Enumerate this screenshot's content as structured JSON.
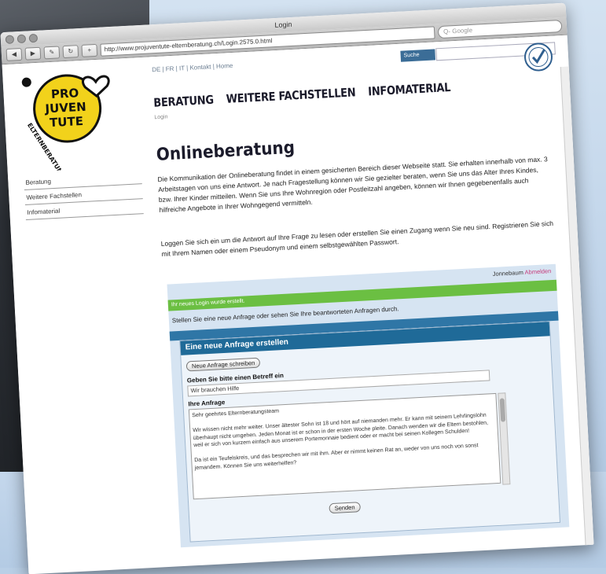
{
  "browser": {
    "title": "Login",
    "url": "http://www.projuventute-elternberatung.ch/Login.2575.0.html",
    "google_placeholder": "Q- Google"
  },
  "site": {
    "logo_text": [
      "PRO",
      "JUVEN",
      "TUTE"
    ],
    "logo_arc_text": "ELTERNBERATUNG",
    "topnav": "DE | FR | IT | Kontakt | Home",
    "search_button": "Suche",
    "nav": [
      "BERATUNG",
      "WEITERE FACHSTELLEN",
      "INFOMATERIAL"
    ],
    "breadcrumb": "Login",
    "sidebar": [
      "Beratung",
      "Weitere Fachstellen",
      "Infomaterial"
    ],
    "colors": {
      "logo_yellow": "#f2d21b",
      "green": "#6bbf42",
      "blue": "#2f76a6",
      "pink": "#c63b7b"
    }
  },
  "main": {
    "heading": "Onlineberatung",
    "para1": "Die Kommunikation der Onlineberatung findet in einem gesicherten Bereich dieser Webseite statt. Sie erhalten innerhalb von max. 3 Arbeitstagen von uns eine Antwort. Je nach Fragestellung können wir Sie gezielter beraten, wenn Sie uns das Alter Ihres Kindes, bzw. Ihrer Kinder mitteilen. Wenn Sie uns Ihre Wohnregion oder Postleitzahl angeben, können wir Ihnen gegebenenfalls auch hilfreiche Angebote in Ihrer Wohngegend vermitteln.",
    "para2": "Loggen Sie sich ein um die Antwort auf Ihre Frage zu lesen oder erstellen Sie einen Zugang wenn Sie neu sind. Registrieren Sie sich mit Ihrem Namen oder einem Pseudonym und einem selbstgewählten Passwort."
  },
  "panel": {
    "user_label": "Jonnebaum",
    "logout": "Abmelden",
    "success": "Ihr neues Login wurde erstellt.",
    "intro": "Stellen Sie eine neue Anfrage oder sehen Sie Ihre beantworteten Anfragen durch.",
    "form_title": "Eine neue Anfrage erstellen",
    "new_button": "Neue Anfrage schreiben",
    "subject_label": "Geben Sie bitte einen Betreff ein",
    "subject_value": "Wir brauchen Hilfe",
    "request_label": "Ihre Anfrage",
    "request_text": "Sehr geehrtes Elternberatungsteam\n\nWir wissen nicht mehr weiter. Unser ältester Sohn ist 18 und hört auf niemanden mehr. Er kann mit seinem Lehrlingslohn überhaupt nicht umgehen. Jeden Monat ist er schon in der ersten Woche pleite. Danach wenden wir die Eltern bestohlen, weil er sich von kurzem einfach aus unserem Portemonnaie bedient oder er macht bei seinen Kollegen Schulden!\n\nDa ist ein Teufelskreis, und das besprechen wir mit ihm. Aber er nimmt keinen Rat an, weder von uns noch von sonst jemandem. Können Sie uns weiterhelfen?",
    "send_button": "Senden"
  }
}
